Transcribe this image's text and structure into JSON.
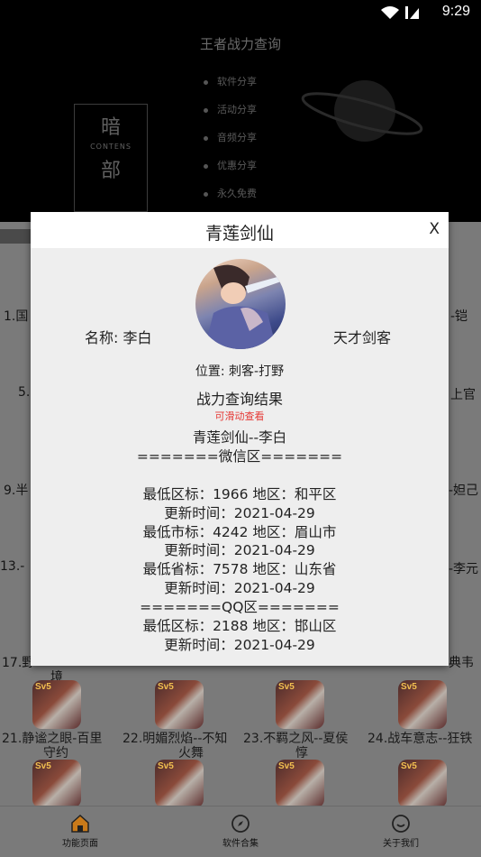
{
  "status_bar": {
    "time": "9:29"
  },
  "banner": {
    "title": "王者战力查询",
    "logo": {
      "top": "暗",
      "middle": "CONTENS",
      "bottom": "部"
    },
    "menu": [
      "软件分享",
      "活动分享",
      "音频分享",
      "优惠分享",
      "永久免费"
    ]
  },
  "grid": {
    "strip_left": [
      "1.国",
      "5.",
      "9.半",
      "13.-",
      "17.野"
    ],
    "strip_right": [
      "-铠",
      "上官",
      "-妲己",
      "-李元",
      "典韦"
    ],
    "row17_wrap": "境",
    "row_items": [
      {
        "label": "21.静谧之眼-百里",
        "wrap": "守约"
      },
      {
        "label": "22.明媚烈焰--不知",
        "wrap": "火舞"
      },
      {
        "label": "23.不羁之风--夏侯",
        "wrap": "惇"
      },
      {
        "label": "24.战车意志--狂铁",
        "wrap": ""
      }
    ],
    "thumb_badge": "Sv5"
  },
  "dialog": {
    "title": "青莲剑仙",
    "close_label": "X",
    "name_line": "名称: 李白",
    "title_line": "天才剑客",
    "position_line": "位置: 刺客-打野",
    "result_title": "战力查询结果",
    "scroll_hint": "可滑动查看",
    "result_lines": [
      "青莲剑仙--李白",
      "=======微信区=======",
      "",
      "最低区标：1966 地区：和平区",
      "更新时间：2021-04-29",
      "最低市标：4242 地区：眉山市",
      "更新时间：2021-04-29",
      "最低省标：7578 地区：山东省",
      "更新时间：2021-04-29",
      "=======QQ区=======",
      "最低区标：2188 地区：邯山区",
      "更新时间：2021-04-29"
    ]
  },
  "tabbar": {
    "tabs": [
      {
        "label": "功能页面",
        "icon": "home-icon"
      },
      {
        "label": "软件合集",
        "icon": "compass-icon"
      },
      {
        "label": "关于我们",
        "icon": "smile-icon"
      }
    ]
  }
}
